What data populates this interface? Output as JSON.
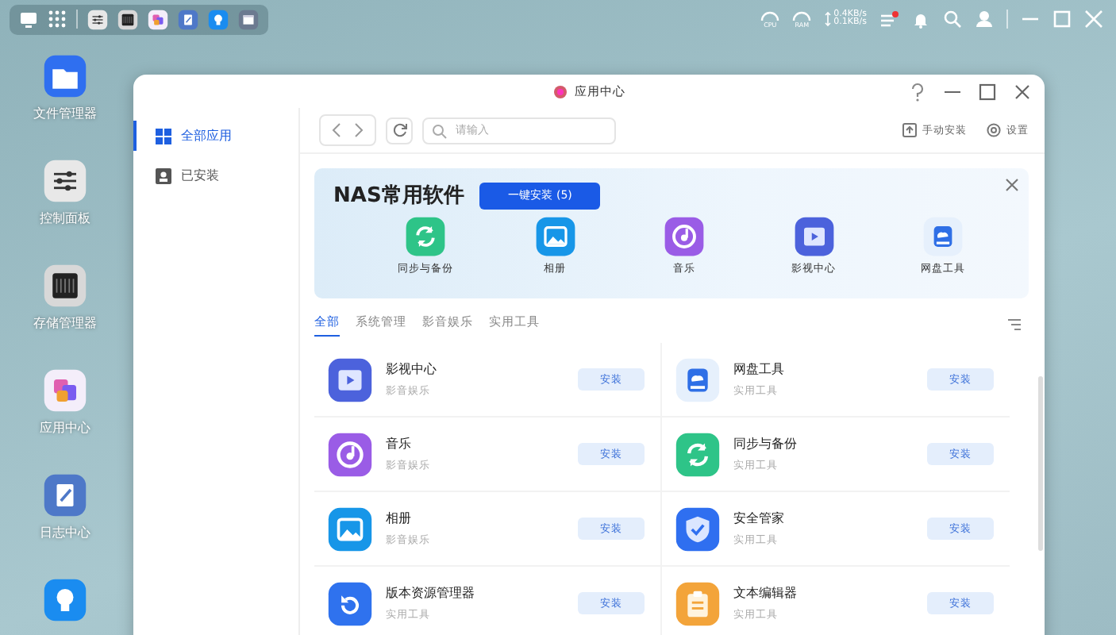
{
  "taskbar": {
    "apps": [
      {
        "kind": "sliders"
      },
      {
        "kind": "terminal"
      },
      {
        "kind": "apps"
      },
      {
        "kind": "notes"
      },
      {
        "kind": "bulb"
      },
      {
        "kind": "panel"
      }
    ],
    "gauges": [
      {
        "label": "CPU"
      },
      {
        "label": "RAM"
      }
    ],
    "upload": "0.4KB/s",
    "download": "0.1KB/s",
    "notification_badge": true
  },
  "desktop": {
    "icons": [
      {
        "kind": "folder",
        "label": "文件管理器"
      },
      {
        "kind": "sliders",
        "label": "控制面板"
      },
      {
        "kind": "terminal",
        "label": "存储管理器"
      },
      {
        "kind": "apps",
        "label": "应用中心"
      },
      {
        "kind": "notes",
        "label": "日志中心"
      },
      {
        "kind": "bulb"
      }
    ]
  },
  "window": {
    "title": "应用中心",
    "sidebar": {
      "items": [
        {
          "label": "全部应用",
          "selected": true,
          "kind": "grid"
        },
        {
          "label": "已安装",
          "selected": false,
          "kind": "installed"
        }
      ]
    },
    "search": {
      "placeholder": "请输入"
    },
    "toolbar_actions": [
      {
        "kind": "upload",
        "label": "手动安装"
      },
      {
        "kind": "gear",
        "label": "设置"
      }
    ],
    "banner": {
      "title": "NAS常用软件",
      "button": "一键安装 (5)",
      "apps": [
        {
          "kind": "sync",
          "label": "同步与备份"
        },
        {
          "kind": "photo",
          "label": "相册"
        },
        {
          "kind": "music",
          "label": "音乐"
        },
        {
          "kind": "video",
          "label": "影视中心"
        },
        {
          "kind": "drive",
          "label": "网盘工具"
        }
      ]
    },
    "tabs": [
      {
        "label": "全部",
        "selected": true
      },
      {
        "label": "系统管理",
        "selected": false
      },
      {
        "label": "影音娱乐",
        "selected": false
      },
      {
        "label": "实用工具",
        "selected": false
      }
    ],
    "apps": [
      {
        "kind": "video",
        "name": "影视中心",
        "category": "影音娱乐",
        "action": "安装"
      },
      {
        "kind": "drive",
        "name": "网盘工具",
        "category": "实用工具",
        "action": "安装"
      },
      {
        "kind": "music",
        "name": "音乐",
        "category": "影音娱乐",
        "action": "安装"
      },
      {
        "kind": "sync",
        "name": "同步与备份",
        "category": "实用工具",
        "action": "安装"
      },
      {
        "kind": "photo",
        "name": "相册",
        "category": "影音娱乐",
        "action": "安装"
      },
      {
        "kind": "shield",
        "name": "安全管家",
        "category": "实用工具",
        "action": "安装"
      },
      {
        "kind": "restore",
        "name": "版本资源管理器",
        "category": "实用工具",
        "action": "安装"
      },
      {
        "kind": "notes2",
        "name": "文本编辑器",
        "category": "实用工具",
        "action": "安装"
      }
    ]
  }
}
